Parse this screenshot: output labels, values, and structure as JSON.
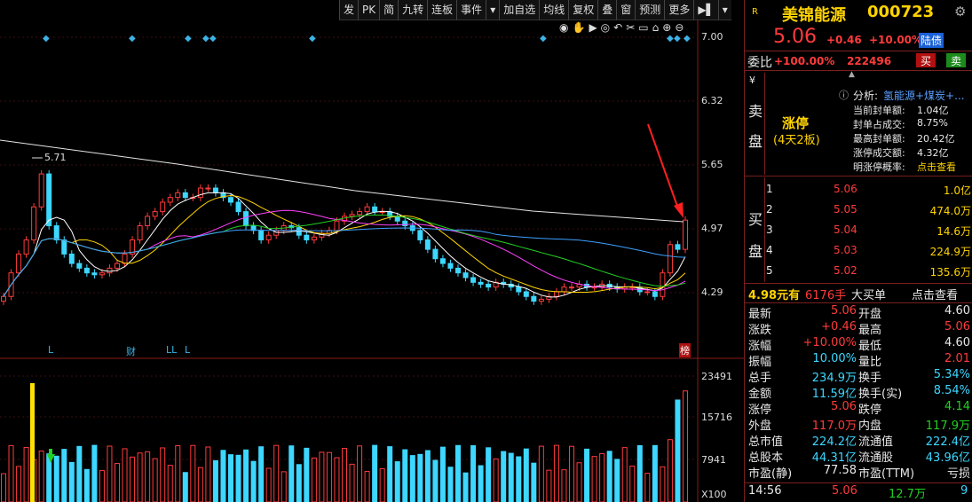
{
  "toolbar": {
    "items": [
      "发",
      "PK",
      "简",
      "九转",
      "连板",
      "事件",
      "▾",
      "加自选",
      "均线",
      "复权",
      "叠",
      "窗",
      "预测",
      "更多",
      "▶▌",
      "▾"
    ]
  },
  "chart_icons": [
    "eye-icon",
    "hand-icon",
    "play-icon",
    "snapshot-icon",
    "undo-icon",
    "bag-icon",
    "lock-icon",
    "zoom-in-icon",
    "zoom-out-icon"
  ],
  "price_axis": [
    "7.00",
    "6.32",
    "5.65",
    "4.97",
    "4.29"
  ],
  "volume_axis": [
    "23491",
    "15716",
    "7941",
    "X100"
  ],
  "high_marker": "5.71",
  "event_labels": [
    "L",
    "财",
    "LL",
    "L",
    "榜"
  ],
  "stock": {
    "badge": "R",
    "name": "美锦能源",
    "code": "000723",
    "price": "5.06",
    "change": "+0.46",
    "change_pct": "+10.00%",
    "tag": "陆债"
  },
  "weibi": {
    "label": "委比",
    "pct": "+100.00%",
    "diff": "222496",
    "buy_btn": "买",
    "sell_btn": "卖"
  },
  "sell_side_label": [
    "¥",
    "卖",
    "盘"
  ],
  "limit_up": {
    "title": "涨停",
    "sub": "(4天2板)",
    "analysis_label": "分析:",
    "analysis_value": "氢能源+煤炭+...",
    "rows": [
      {
        "k": "当前封单额:",
        "v": "1.04亿"
      },
      {
        "k": "封单占成交:",
        "v": "8.75%"
      },
      {
        "k": "最高封单额:",
        "v": "20.42亿"
      },
      {
        "k": "涨停成交额:",
        "v": "4.32亿"
      },
      {
        "k": "明涨停概率:",
        "v": "点击查看"
      }
    ]
  },
  "buy_side_label": [
    "买",
    "盘"
  ],
  "buy_orders": [
    {
      "lvl": "1",
      "price": "5.06",
      "vol": "1.0亿"
    },
    {
      "lvl": "2",
      "price": "5.05",
      "vol": "474.0万"
    },
    {
      "lvl": "3",
      "price": "5.04",
      "vol": "14.6万"
    },
    {
      "lvl": "4",
      "price": "5.03",
      "vol": "224.9万"
    },
    {
      "lvl": "5",
      "price": "5.02",
      "vol": "135.6万"
    }
  ],
  "big_order": {
    "price": "4.98元有",
    "vol": "6176手",
    "type": "大买单",
    "link": "点击查看"
  },
  "stats": [
    {
      "k1": "最新",
      "v1": "5.06",
      "c1": "red",
      "k2": "开盘",
      "v2": "4.60",
      "c2": "white"
    },
    {
      "k1": "涨跌",
      "v1": "+0.46",
      "c1": "red",
      "k2": "最高",
      "v2": "5.06",
      "c2": "red"
    },
    {
      "k1": "涨幅",
      "v1": "+10.00%",
      "c1": "red",
      "k2": "最低",
      "v2": "4.60",
      "c2": "white"
    },
    {
      "k1": "振幅",
      "v1": "10.00%",
      "c1": "cyan",
      "k2": "量比",
      "v2": "2.01",
      "c2": "red"
    },
    {
      "k1": "总手",
      "v1": "234.9万",
      "c1": "cyan",
      "k2": "换手",
      "v2": "5.34%",
      "c2": "cyan"
    },
    {
      "k1": "金额",
      "v1": "11.59亿",
      "c1": "cyan",
      "k2": "换手(实)",
      "v2": "8.54%",
      "c2": "cyan"
    },
    {
      "k1": "涨停",
      "v1": "5.06",
      "c1": "red",
      "k2": "跌停",
      "v2": "4.14",
      "c2": "green"
    },
    {
      "k1": "外盘",
      "v1": "117.0万",
      "c1": "red",
      "k2": "内盘",
      "v2": "117.9万",
      "c2": "green"
    },
    {
      "k1": "总市值",
      "v1": "224.2亿",
      "c1": "cyan",
      "k2": "流通值",
      "v2": "222.4亿",
      "c2": "cyan"
    },
    {
      "k1": "总股本",
      "v1": "44.31亿",
      "c1": "cyan",
      "k2": "流通股",
      "v2": "43.96亿",
      "c2": "cyan"
    },
    {
      "k1": "市盈(静)",
      "v1": "77.58",
      "c1": "white",
      "k2": "市盈(TTM)",
      "v2": "亏损",
      "c2": "white"
    }
  ],
  "tick": {
    "time": "14:56",
    "price": "5.06",
    "vol": "12.7万",
    "count": "9"
  },
  "chart_data": {
    "type": "candlestick",
    "price_axis_ticks": [
      7.0,
      6.32,
      5.65,
      4.97,
      4.29
    ],
    "volume_axis_ticks": [
      23491,
      15716,
      7941
    ],
    "closes": [
      4.25,
      4.5,
      4.7,
      4.85,
      5.2,
      5.55,
      5.0,
      4.85,
      4.7,
      4.6,
      4.55,
      4.5,
      4.48,
      4.5,
      4.55,
      4.6,
      4.7,
      4.85,
      5.0,
      5.1,
      5.15,
      5.25,
      5.3,
      5.35,
      5.3,
      5.3,
      5.4,
      5.4,
      5.35,
      5.3,
      5.25,
      5.15,
      5.0,
      4.95,
      4.85,
      4.9,
      4.95,
      5.0,
      4.98,
      4.9,
      4.85,
      4.88,
      4.92,
      4.95,
      5.05,
      5.1,
      5.12,
      5.15,
      5.2,
      5.15,
      5.15,
      5.1,
      5.05,
      5.0,
      4.95,
      4.85,
      4.75,
      4.65,
      4.6,
      4.55,
      4.5,
      4.45,
      4.4,
      4.38,
      4.35,
      4.4,
      4.38,
      4.35,
      4.3,
      4.25,
      4.2,
      4.22,
      4.25,
      4.3,
      4.35,
      4.35,
      4.38,
      4.35,
      4.35,
      4.38,
      4.35,
      4.33,
      4.35,
      4.35,
      4.3,
      4.3,
      4.25,
      4.5,
      4.8,
      4.75,
      5.06
    ]
  }
}
